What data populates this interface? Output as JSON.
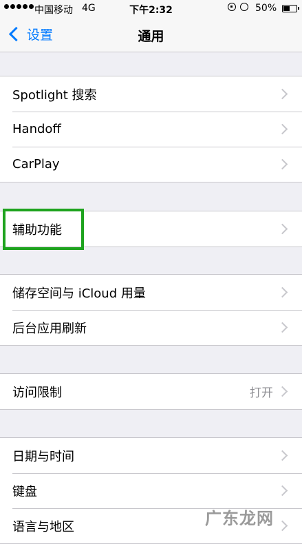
{
  "status_bar": {
    "carrier": "中国移动",
    "network": "4G",
    "time": "下午2:32",
    "battery_percent": "50%",
    "battery_level": 0.5
  },
  "nav": {
    "back_label": "设置",
    "title": "通用"
  },
  "groups": [
    {
      "items": [
        {
          "label": "Spotlight 搜索"
        },
        {
          "label": "Handoff"
        },
        {
          "label": "CarPlay"
        }
      ]
    },
    {
      "items": [
        {
          "label": "辅助功能"
        }
      ]
    },
    {
      "items": [
        {
          "label": "储存空间与 iCloud 用量"
        },
        {
          "label": "后台应用刷新"
        }
      ]
    },
    {
      "items": [
        {
          "label": "访问限制",
          "value": "打开"
        }
      ]
    },
    {
      "items": [
        {
          "label": "日期与时间"
        },
        {
          "label": "键盘"
        },
        {
          "label": "语言与地区"
        }
      ]
    }
  ],
  "watermark": "广东龙网",
  "colors": {
    "accent": "#007aff",
    "highlight": "#1ea31e",
    "background": "#efeff4"
  }
}
